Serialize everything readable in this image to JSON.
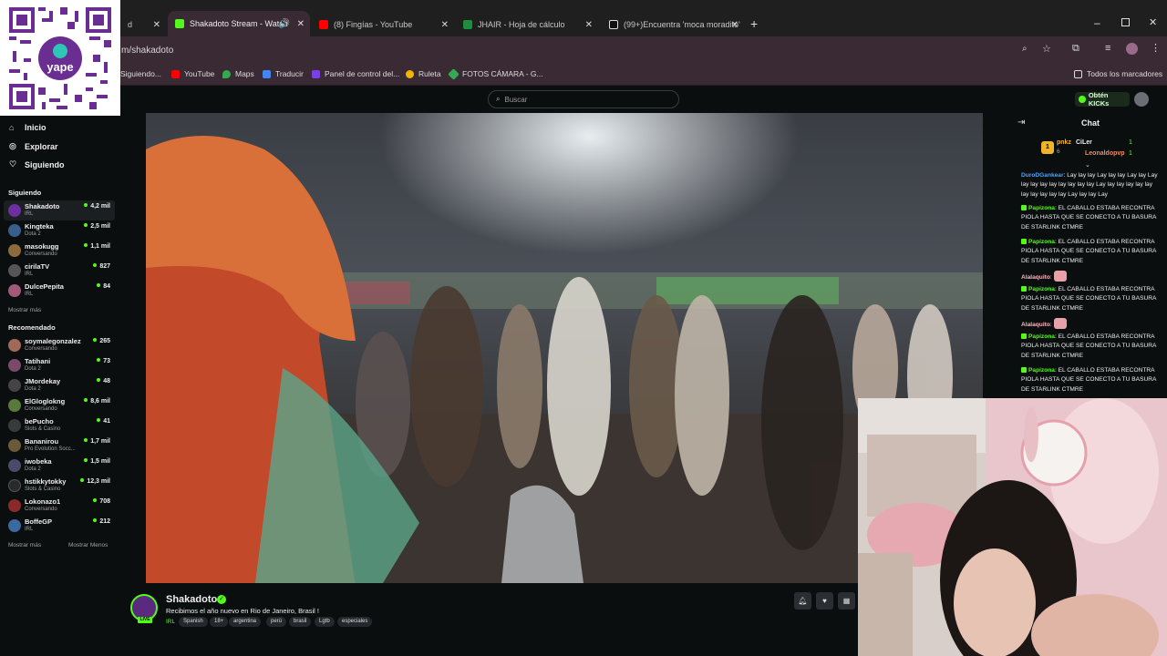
{
  "browser": {
    "tabs": [
      {
        "label": "d",
        "fav": "#888"
      },
      {
        "label": "Shakadoto Stream - Watch",
        "fav": "#53fc18",
        "active": true
      },
      {
        "label": "(8) Fingías - YouTube",
        "fav": "#ff0000"
      },
      {
        "label": "JHAIR - Hoja de cálculo",
        "fav": "#1e8e3e"
      },
      {
        "label": "(99+)Encuentra 'moca moradito'",
        "fav": "#111"
      }
    ],
    "url": "m/shakadoto",
    "bookmarks": [
      {
        "label": "Siguiendo...",
        "color": "#777"
      },
      {
        "label": "YouTube",
        "color": "#ff0000"
      },
      {
        "label": "Maps",
        "color": "#34a853"
      },
      {
        "label": "Traducir",
        "color": "#4285f4"
      },
      {
        "label": "Panel de control del...",
        "color": "#7b3fe4"
      },
      {
        "label": "Ruleta",
        "color": "#f4b400"
      },
      {
        "label": "FOTOS CÁMARA - G...",
        "color": "#34a853"
      }
    ],
    "all_bookmarks": "Todos los marcadores"
  },
  "qr": {
    "brand": "yape"
  },
  "header": {
    "search_placeholder": "Buscar",
    "kicks_button": "Obtén KICKs"
  },
  "sidebar": {
    "nav": [
      {
        "label": "Inicio",
        "icon": "home-icon"
      },
      {
        "label": "Explorar",
        "icon": "compass-icon"
      },
      {
        "label": "Siguiendo",
        "icon": "heart-icon"
      }
    ],
    "following_header": "Siguiendo",
    "following": [
      {
        "name": "Shakadoto",
        "category": "IRL",
        "viewers": "4,2 mil",
        "color": "#6b2fa0"
      },
      {
        "name": "Kingteka",
        "category": "Dota 2",
        "viewers": "2,5 mil",
        "color": "#3a5e8c"
      },
      {
        "name": "masokugg",
        "category": "Conversando",
        "viewers": "1,1 mil",
        "color": "#8c6a3a"
      },
      {
        "name": "cirilaTV",
        "category": "IRL",
        "viewers": "827",
        "color": "#555"
      },
      {
        "name": "DulcePepita",
        "category": "IRL",
        "viewers": "84",
        "color": "#a05a7a"
      }
    ],
    "following_more": "Mostrar más",
    "recommended_header": "Recomendado",
    "recommended": [
      {
        "name": "soymalegonzalez",
        "category": "Conversando",
        "viewers": "265",
        "color": "#a06a5a"
      },
      {
        "name": "Tatihani",
        "category": "Dota 2",
        "viewers": "73",
        "color": "#7a4a6a"
      },
      {
        "name": "JMordekay",
        "category": "Dota 2",
        "viewers": "48",
        "color": "#444"
      },
      {
        "name": "ElGloglokng",
        "category": "Conversando",
        "viewers": "8,6 mil",
        "color": "#5a7a3a"
      },
      {
        "name": "bePucho",
        "category": "Slots & Casino",
        "viewers": "41",
        "color": "#3a3a3a"
      },
      {
        "name": "Bananirou",
        "category": "Pro Evolution Socc...",
        "viewers": "1,7 mil",
        "color": "#6a5a3a"
      },
      {
        "name": "iwobeka",
        "category": "Dota 2",
        "viewers": "1,5 mil",
        "color": "#4a4a6a"
      },
      {
        "name": "hstikkytokky",
        "category": "Slots & Casino",
        "viewers": "12,3 mil",
        "color": "#2a2a2a"
      },
      {
        "name": "Lokonazo1",
        "category": "Conversando",
        "viewers": "708",
        "color": "#8a2a2a"
      },
      {
        "name": "BoffeGP",
        "category": "IRL",
        "viewers": "212",
        "color": "#3a6aa0"
      }
    ],
    "show_more": "Mostrar más",
    "show_less": "Mostrar Menos"
  },
  "stream": {
    "streamer": "Shakadoto",
    "live": "LIVE",
    "title": "Recibimos el año nuevo en Rio de Janeiro, Brasil !",
    "category": "IRL",
    "tags": [
      "Spanish",
      "18+",
      "argentina",
      "perù",
      "brasil",
      "Lgtb",
      "especiales"
    ]
  },
  "chat": {
    "title": "Chat",
    "top_gifters": [
      {
        "name": "pnkz",
        "count": "6"
      },
      {
        "name": "CiLer",
        "count": "1"
      },
      {
        "name": "Leonaldopvp",
        "count": "1"
      }
    ],
    "messages": [
      {
        "user": "DuroDGankear",
        "user_color": "#4aa3ff",
        "text": "Lay lay lay Lay lay lay Lay lay Lay lay lay lay lay lay lay lay lay Lay lay lay lay lay lay lay lay lay lay lay Lay lay lay Lay"
      },
      {
        "user": "Papizona",
        "user_color": "#53fc18",
        "text": "EL CABALLO ESTABA RECONTRA PIOLA HASTA QUE SE CONECTO A TU BASURA DE STARLINK CTMRE"
      },
      {
        "user": "Papizona",
        "user_color": "#53fc18",
        "text": "EL CABALLO ESTABA RECONTRA PIOLA HASTA QUE SE CONECTO A TU BASURA DE STARLINK CTMRE"
      },
      {
        "user": "Alalaquito",
        "user_color": "#ffb5c0",
        "text": ""
      },
      {
        "user": "Papizona",
        "user_color": "#53fc18",
        "text": "EL CABALLO ESTABA RECONTRA PIOLA HASTA QUE SE CONECTO A TU BASURA DE STARLINK CTMRE"
      },
      {
        "user": "Alalaquito",
        "user_color": "#ffb5c0",
        "text": ""
      },
      {
        "user": "Papizona",
        "user_color": "#53fc18",
        "text": "EL CABALLO ESTABA RECONTRA PIOLA HASTA QUE SE CONECTO A TU BASURA DE STARLINK CTMRE"
      },
      {
        "user": "Papizona",
        "user_color": "#53fc18",
        "text": "EL CABALLO ESTABA RECONTRA PIOLA HASTA QUE SE CONECTO A TU BASURA DE STARLINK CTMRE"
      }
    ]
  }
}
